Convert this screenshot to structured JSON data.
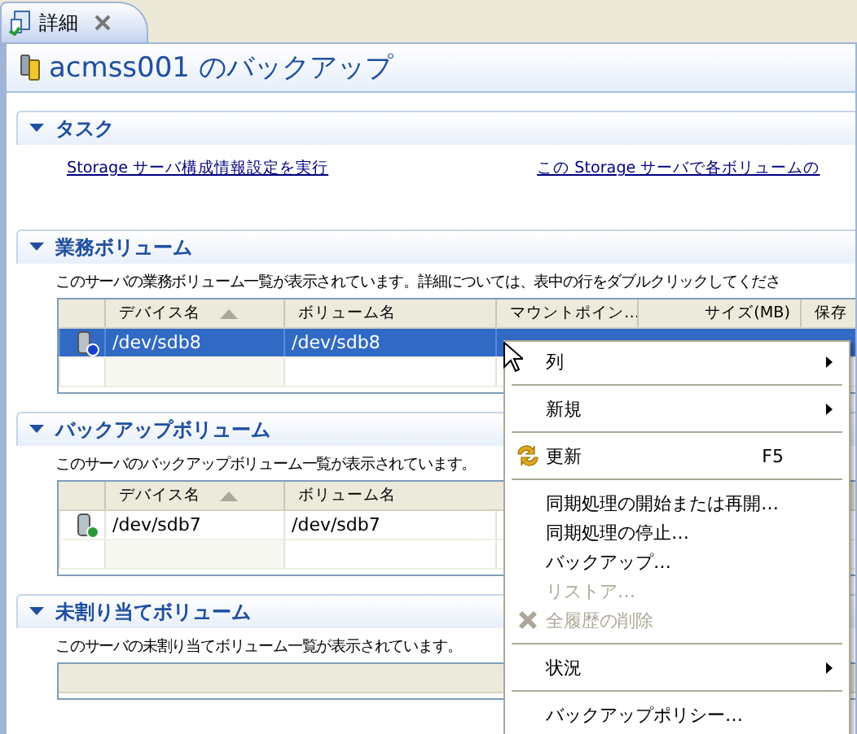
{
  "tab": {
    "label": "詳細",
    "selected": true
  },
  "page_title": "acmss001 のバックアップ",
  "sections": [
    {
      "title": "タスク",
      "expanded": true,
      "kind": "links",
      "links": [
        "Storage サーバ構成情報設定を実行",
        "この Storage サーバで各ボリュームの"
      ]
    },
    {
      "title": "業務ボリューム",
      "expanded": true,
      "kind": "table",
      "description": "このサーバの業務ボリューム一覧が表示されています。詳細については、表中の行をダブルクリックしてくださ",
      "columns": [
        {
          "label": "デバイス名",
          "sort_ascending": true
        },
        {
          "label": "ボリューム名",
          "sort_ascending": false
        },
        {
          "label": "マウントポイン…",
          "sort_ascending": false
        },
        {
          "label": "サイズ(MB)",
          "sort_ascending": false
        },
        {
          "label": "保存",
          "sort_ascending": false
        }
      ],
      "rows": [
        {
          "kind": "business",
          "selected": true,
          "cells": [
            "/dev/sdb8",
            "/dev/sdb8"
          ]
        }
      ]
    },
    {
      "title": "バックアップボリューム",
      "expanded": true,
      "kind": "table",
      "description": "このサーバのバックアップボリューム一覧が表示されています。",
      "columns": [
        {
          "label": "デバイス名",
          "sort_ascending": true
        },
        {
          "label": "ボリューム名",
          "sort_ascending": false
        }
      ],
      "rows": [
        {
          "kind": "backup",
          "selected": false,
          "cells": [
            "/dev/sdb7",
            "/dev/sdb7"
          ]
        }
      ]
    },
    {
      "title": "未割り当てボリューム",
      "expanded": true,
      "kind": "table",
      "description": "このサーバの未割り当てボリューム一覧が表示されています。"
    }
  ],
  "context_menu": [
    {
      "kind": "item",
      "label": "列",
      "submenu": true,
      "disabled": false
    },
    {
      "kind": "separator"
    },
    {
      "kind": "item",
      "label": "新規",
      "submenu": true,
      "disabled": false
    },
    {
      "kind": "separator"
    },
    {
      "kind": "refresh",
      "label": "更新",
      "shortcut": "F5",
      "submenu": false,
      "disabled": false
    },
    {
      "kind": "separator"
    },
    {
      "kind": "item",
      "label": "同期処理の開始または再開…",
      "submenu": false,
      "disabled": false
    },
    {
      "kind": "item",
      "label": "同期処理の停止…",
      "submenu": false,
      "disabled": false
    },
    {
      "kind": "item",
      "label": "バックアップ…",
      "submenu": false,
      "disabled": false
    },
    {
      "kind": "item",
      "label": "リストア…",
      "submenu": false,
      "disabled": true
    },
    {
      "kind": "delete",
      "label": "全履歴の削除",
      "submenu": false,
      "disabled": true
    },
    {
      "kind": "separator"
    },
    {
      "kind": "item",
      "label": "状況",
      "submenu": true,
      "disabled": false
    },
    {
      "kind": "separator"
    },
    {
      "kind": "item",
      "label": "バックアップポリシー…",
      "submenu": false,
      "disabled": false
    }
  ]
}
